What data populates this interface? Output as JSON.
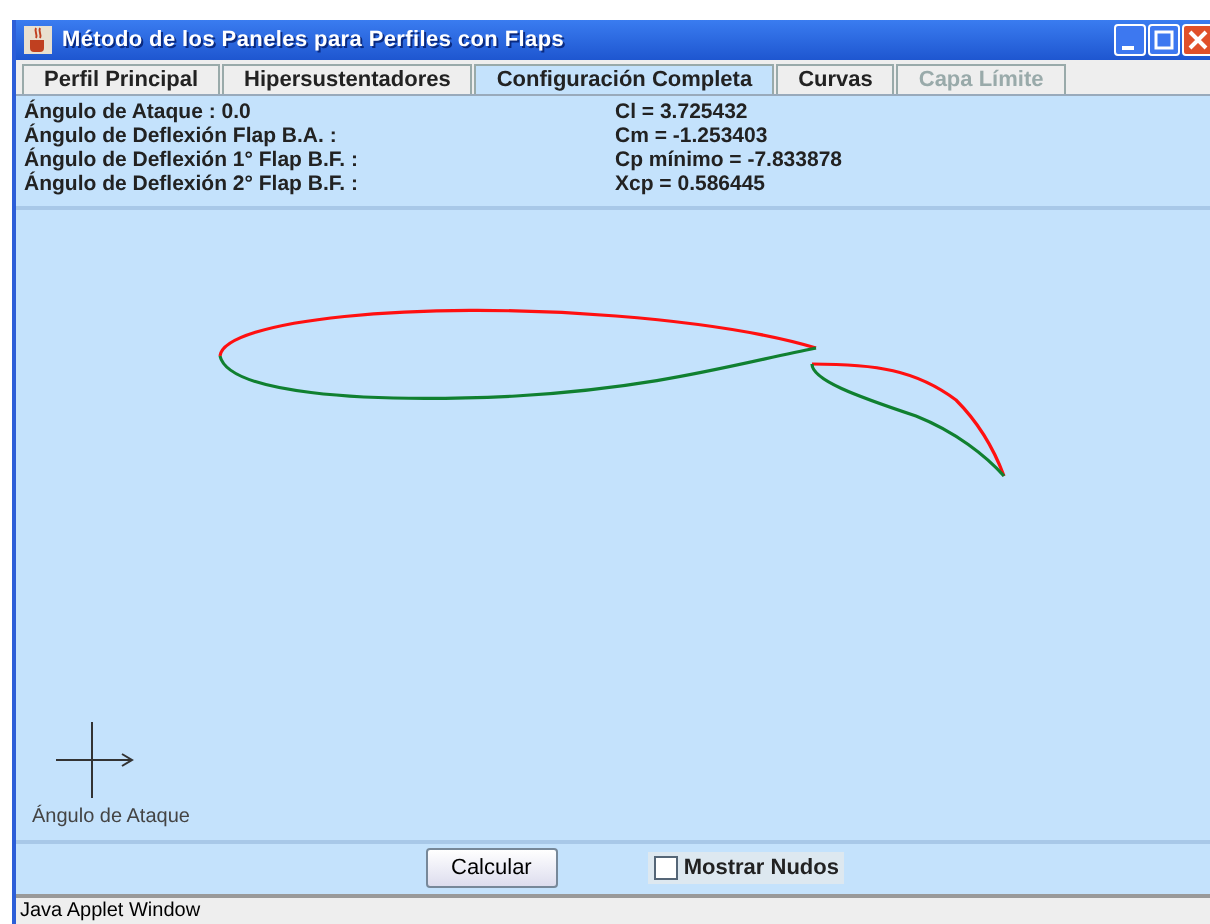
{
  "window": {
    "title": "Método de los Paneles para Perfiles con Flaps"
  },
  "tabs": [
    {
      "label": "Perfil Principal",
      "selected": false,
      "disabled": false
    },
    {
      "label": "Hipersustentadores",
      "selected": false,
      "disabled": false
    },
    {
      "label": "Configuración Completa",
      "selected": true,
      "disabled": false
    },
    {
      "label": "Curvas",
      "selected": false,
      "disabled": false
    },
    {
      "label": "Capa Límite",
      "selected": false,
      "disabled": true
    }
  ],
  "info_left": [
    "Ángulo de Ataque : 0.0",
    "Ángulo de Deflexión Flap B.A. :",
    "Ángulo de Deflexión 1° Flap B.F. :",
    "Ángulo de Deflexión 2° Flap B.F. :"
  ],
  "info_right": [
    "Cl = 3.725432",
    "Cm = -1.253403",
    "Cp mínimo = -7.833878",
    "Xcp = 0.586445"
  ],
  "canvas": {
    "axis_label": "Ángulo de Ataque"
  },
  "buttons": {
    "calculate": "Calcular"
  },
  "show_nodes": {
    "label": "Mostrar Nudos",
    "checked": false
  },
  "status_bar": "Java Applet Window"
}
